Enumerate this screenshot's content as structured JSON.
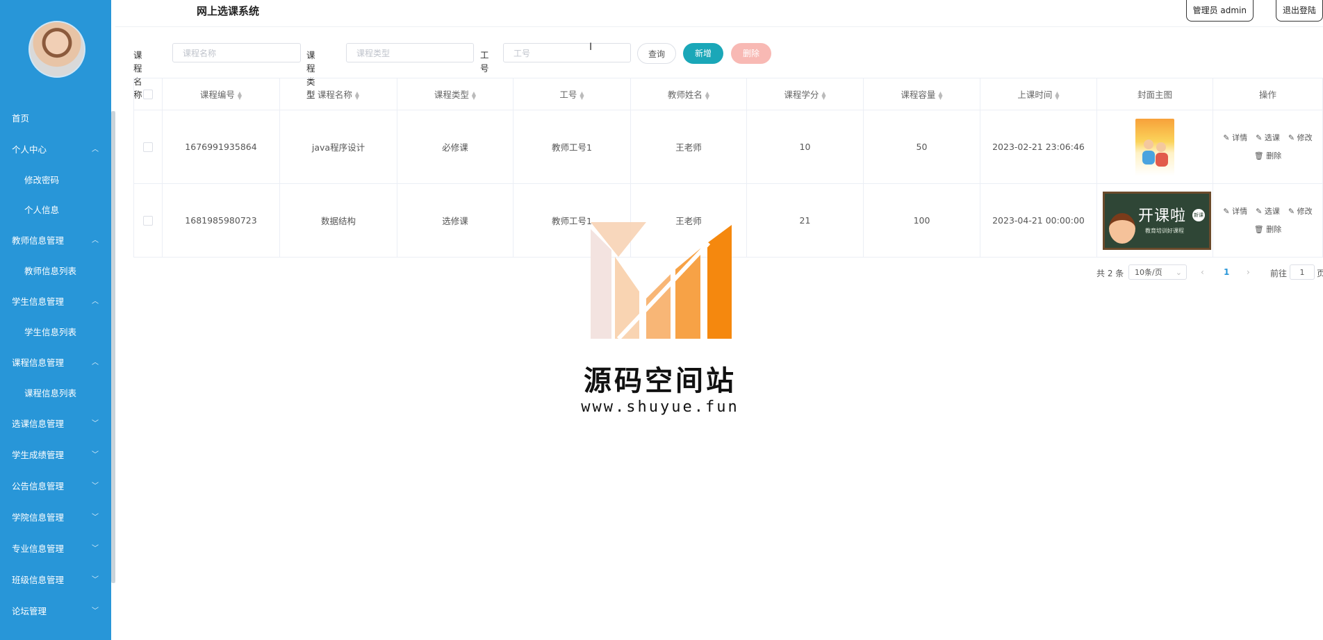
{
  "header": {
    "title": "网上选课系统",
    "admin_label": "管理员 admin",
    "logout_label": "退出登陆"
  },
  "sidebar": {
    "items": [
      {
        "label": "首页",
        "type": "top",
        "chevron": ""
      },
      {
        "label": "个人中心",
        "type": "group",
        "chevron": "^"
      },
      {
        "label": "修改密码",
        "type": "sub",
        "chevron": ""
      },
      {
        "label": "个人信息",
        "type": "sub",
        "chevron": ""
      },
      {
        "label": "教师信息管理",
        "type": "group",
        "chevron": "^"
      },
      {
        "label": "教师信息列表",
        "type": "sub",
        "chevron": ""
      },
      {
        "label": "学生信息管理",
        "type": "group",
        "chevron": "^"
      },
      {
        "label": "学生信息列表",
        "type": "sub",
        "chevron": ""
      },
      {
        "label": "课程信息管理",
        "type": "group",
        "chevron": "^"
      },
      {
        "label": "课程信息列表",
        "type": "sub",
        "chevron": ""
      },
      {
        "label": "选课信息管理",
        "type": "group",
        "chevron": "v"
      },
      {
        "label": "学生成绩管理",
        "type": "group",
        "chevron": "v"
      },
      {
        "label": "公告信息管理",
        "type": "group",
        "chevron": "v"
      },
      {
        "label": "学院信息管理",
        "type": "group",
        "chevron": "v"
      },
      {
        "label": "专业信息管理",
        "type": "group",
        "chevron": "v"
      },
      {
        "label": "班级信息管理",
        "type": "group",
        "chevron": "v"
      },
      {
        "label": "论坛管理",
        "type": "group",
        "chevron": "v"
      }
    ]
  },
  "search": {
    "course_name_label": "课程名称",
    "course_name_placeholder": "课程名称",
    "course_type_label": "课程类型",
    "course_type_placeholder": "课程类型",
    "staff_no_label": "工号",
    "staff_no_placeholder": "工号",
    "query_label": "查询",
    "add_label": "新增",
    "delete_label": "删除"
  },
  "table": {
    "columns": [
      "课程编号",
      "课程名称",
      "课程类型",
      "工号",
      "教师姓名",
      "课程学分",
      "课程容量",
      "上课时间",
      "封面主图",
      "操作"
    ],
    "rows": [
      {
        "id": "1676991935864",
        "name": "java程序设计",
        "type": "必修课",
        "staff_no": "教师工号1",
        "teacher": "王老师",
        "credit": "10",
        "capacity": "50",
        "time": "2023-02-21 23:06:46"
      },
      {
        "id": "1681985980723",
        "name": "数据结构",
        "type": "选修课",
        "staff_no": "教师工号1",
        "teacher": "王老师",
        "credit": "21",
        "capacity": "100",
        "time": "2023-04-21 00:00:00"
      }
    ],
    "cover2_text": "开课啦",
    "cover2_sub": "教育培训好课程",
    "cover2_badge": "新课",
    "ops": {
      "detail": "详情",
      "select": "选课",
      "edit": "修改",
      "delete": "删除"
    }
  },
  "pagination": {
    "total": "共 2 条",
    "page_size": "10条/页",
    "current": "1",
    "goto_label": "前往",
    "goto_value": "1",
    "page_suffix": "页"
  },
  "watermark": {
    "title": "源码空间站",
    "url": "www.shuyue.fun"
  },
  "colors": {
    "sidebar": "#2896d8",
    "add_button": "#1aa7b8",
    "delete_button": "#f8b9b4",
    "watermark_orange": "#f5880e"
  }
}
